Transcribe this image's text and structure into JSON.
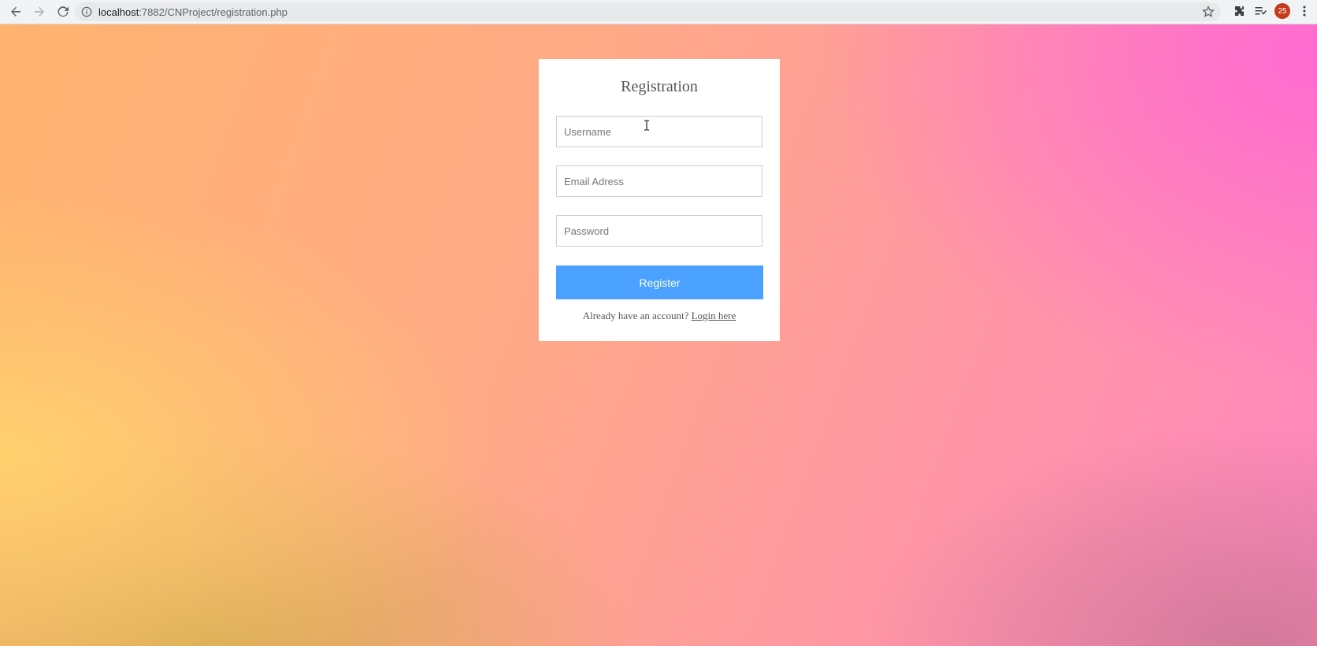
{
  "browser": {
    "url_host": "localhost",
    "url_path": ":7882/CNProject/registration.php",
    "avatar_text": "25"
  },
  "form": {
    "title": "Registration",
    "username_placeholder": "Username",
    "email_placeholder": "Email Adress",
    "password_placeholder": "Password",
    "register_label": "Register",
    "already_text": "Already have an account?",
    "login_link": "Login here"
  },
  "colors": {
    "button": "#4aa1ff",
    "avatar": "#c43b1c"
  }
}
